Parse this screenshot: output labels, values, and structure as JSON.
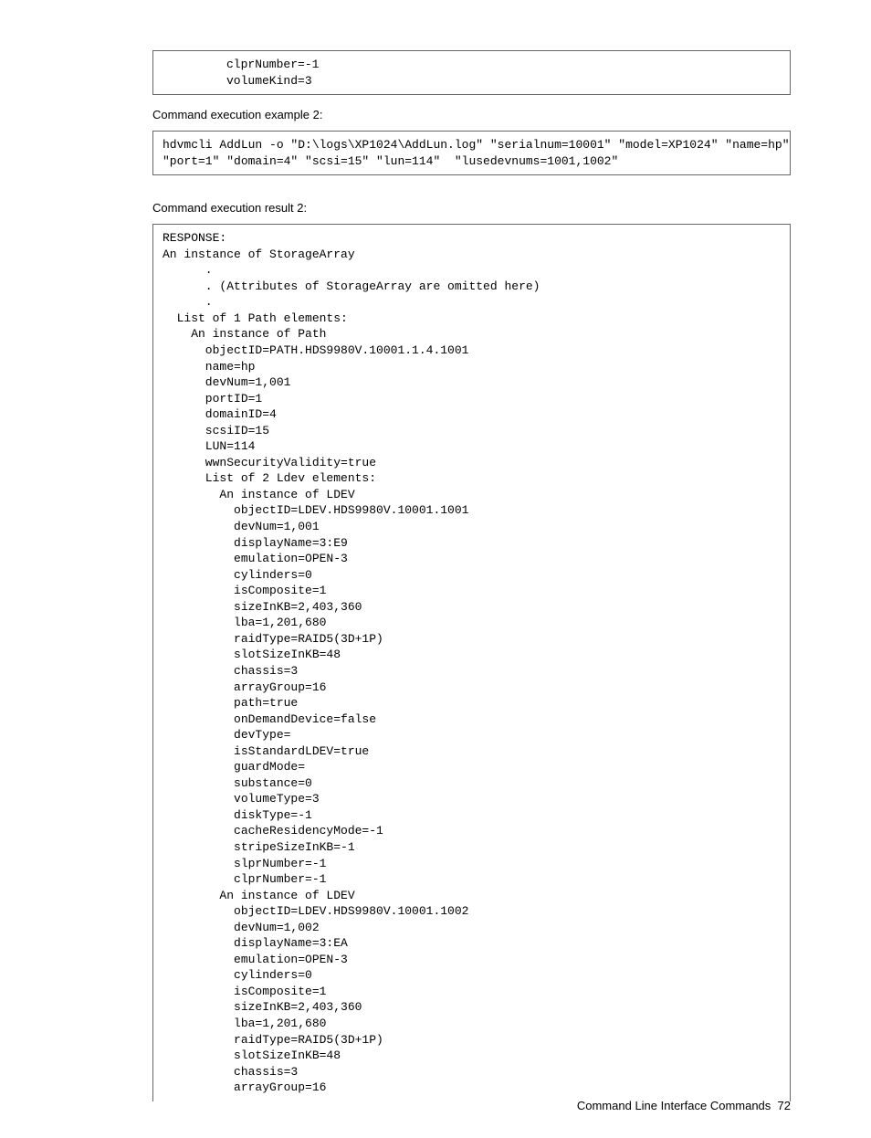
{
  "topCode": "clprNumber=-1\nvolumeKind=3",
  "label1": "Command execution example 2:",
  "codeExample": "hdvmcli AddLun -o \"D:\\logs\\XP1024\\AddLun.log\" \"serialnum=10001\" \"model=XP1024\" \"name=hp\"\n\"port=1\" \"domain=4\" \"scsi=15\" \"lun=114\"  \"lusedevnums=1001,1002\"",
  "label2": "Command execution result 2:",
  "codeResult": "RESPONSE:\nAn instance of StorageArray\n      .\n      . (Attributes of StorageArray are omitted here)\n      .\n  List of 1 Path elements:\n    An instance of Path\n      objectID=PATH.HDS9980V.10001.1.4.1001\n      name=hp\n      devNum=1,001\n      portID=1\n      domainID=4\n      scsiID=15\n      LUN=114\n      wwnSecurityValidity=true\n      List of 2 Ldev elements:\n        An instance of LDEV\n          objectID=LDEV.HDS9980V.10001.1001\n          devNum=1,001\n          displayName=3:E9\n          emulation=OPEN-3\n          cylinders=0\n          isComposite=1\n          sizeInKB=2,403,360\n          lba=1,201,680\n          raidType=RAID5(3D+1P)\n          slotSizeInKB=48\n          chassis=3\n          arrayGroup=16\n          path=true\n          onDemandDevice=false\n          devType=\n          isStandardLDEV=true\n          guardMode=\n          substance=0\n          volumeType=3\n          diskType=-1\n          cacheResidencyMode=-1\n          stripeSizeInKB=-1\n          slprNumber=-1\n          clprNumber=-1\n        An instance of LDEV\n          objectID=LDEV.HDS9980V.10001.1002\n          devNum=1,002\n          displayName=3:EA\n          emulation=OPEN-3\n          cylinders=0\n          isComposite=1\n          sizeInKB=2,403,360\n          lba=1,201,680\n          raidType=RAID5(3D+1P)\n          slotSizeInKB=48\n          chassis=3\n          arrayGroup=16",
  "footer": {
    "title": "Command Line Interface Commands",
    "page": "72"
  }
}
